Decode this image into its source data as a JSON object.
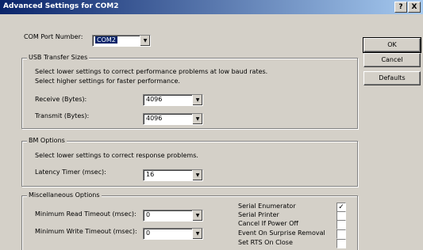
{
  "window": {
    "title": "Advanced Settings for COM2",
    "help_label": "?",
    "close_label": "X"
  },
  "com_port": {
    "label": "COM Port Number:",
    "value": "COM2"
  },
  "buttons": {
    "ok": "OK",
    "cancel": "Cancel",
    "defaults": "Defaults"
  },
  "usb": {
    "title": "USB Transfer Sizes",
    "desc1": "Select lower settings to correct performance problems at low baud rates.",
    "desc2": "Select higher settings for faster performance.",
    "receive_label": "Receive (Bytes):",
    "receive_value": "4096",
    "transmit_label": "Transmit (Bytes):",
    "transmit_value": "4096"
  },
  "bm": {
    "title": "BM Options",
    "desc": "Select lower settings to correct response problems.",
    "latency_label": "Latency Timer (msec):",
    "latency_value": "16"
  },
  "misc": {
    "title": "Miscellaneous Options",
    "min_read_label": "Minimum Read Timeout (msec):",
    "min_read_value": "0",
    "min_write_label": "Minimum Write Timeout (msec):",
    "min_write_value": "0",
    "checkboxes": [
      {
        "label": "Serial Enumerator",
        "checked": true,
        "mark": "✓"
      },
      {
        "label": "Serial Printer",
        "checked": false,
        "mark": ""
      },
      {
        "label": "Cancel If Power Off",
        "checked": false,
        "mark": ""
      },
      {
        "label": "Event On Surprise Removal",
        "checked": false,
        "mark": ""
      },
      {
        "label": "Set RTS On Close",
        "checked": false,
        "mark": ""
      }
    ]
  }
}
